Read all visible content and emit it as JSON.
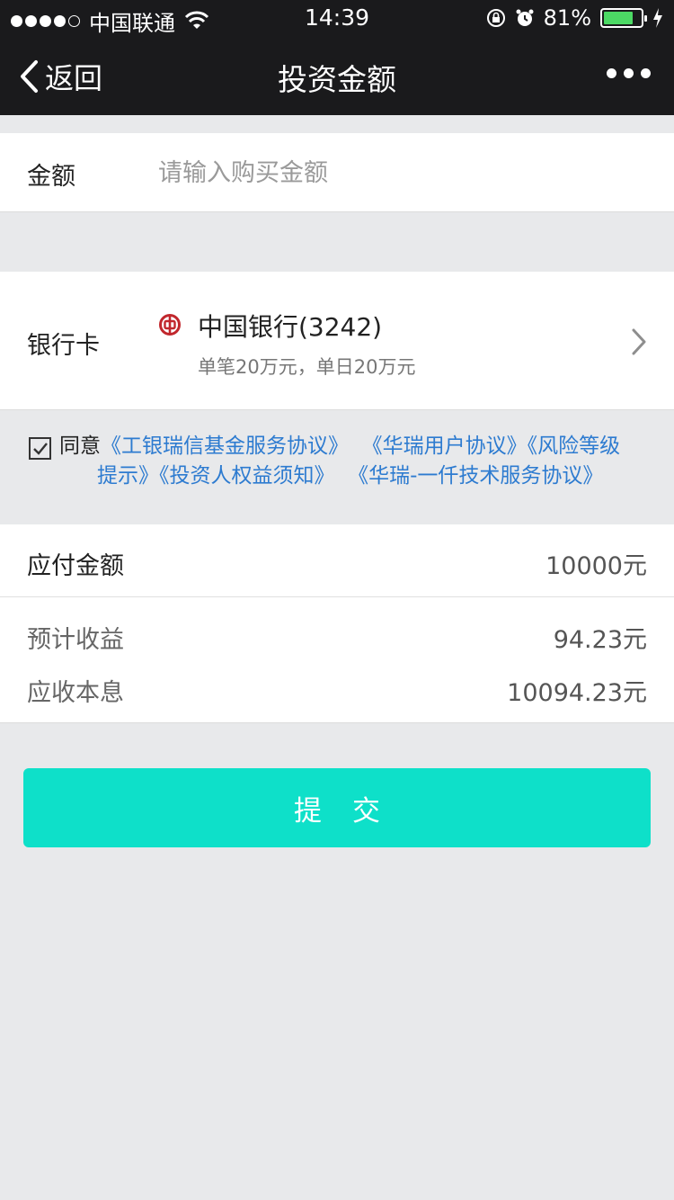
{
  "status_bar": {
    "carrier": "中国联通",
    "time": "14:39",
    "battery_percent": "81%",
    "battery_level": 0.81
  },
  "nav": {
    "back_label": "返回",
    "title": "投资金额"
  },
  "amount": {
    "label": "金额",
    "placeholder": "请输入购买金额",
    "value": ""
  },
  "bank": {
    "label": "银行卡",
    "name": "中国银行(3242)",
    "limit": "单笔20万元，单日20万元",
    "brand_color": "#c1272d"
  },
  "agreement": {
    "checked": true,
    "prefix": "同意",
    "links_line1": [
      "《工银瑞信基金服务协议》",
      "《华瑞用户协议》",
      "《风险等级"
    ],
    "links_line2": [
      "提示》",
      "《投资人权益须知》",
      "《华瑞-一仟技术服务协议》"
    ],
    "link_color": "#2d7bd0"
  },
  "payment": {
    "due_label": "应付金额",
    "due_value": "10000元",
    "expected_label": "预计收益",
    "expected_value": "94.23元",
    "principal_label": "应收本息",
    "principal_value": "10094.23元"
  },
  "submit": {
    "label": "提交",
    "color": "#0ee0c9"
  }
}
